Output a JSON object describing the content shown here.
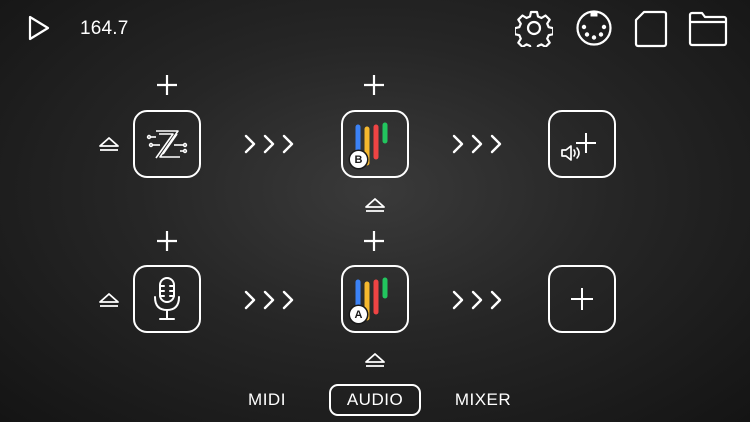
{
  "transport": {
    "tempo": "164.7",
    "play_icon": "play-icon"
  },
  "toolbar": {
    "icons": [
      "settings-gear-icon",
      "midi-connector-icon",
      "document-icon",
      "folder-icon"
    ]
  },
  "chains": [
    {
      "input": "zeeon-synth-icon",
      "effect_badge": "B",
      "output": "add-audio-output-icon"
    },
    {
      "input": "microphone-icon",
      "effect_badge": "A",
      "output": "add-slot-icon"
    }
  ],
  "meter_colors": [
    "#3b82f6",
    "#f5b82e",
    "#ef4444",
    "#22c55e"
  ],
  "tabs": [
    {
      "label": "MIDI",
      "active": false
    },
    {
      "label": "AUDIO",
      "active": true
    },
    {
      "label": "MIXER",
      "active": false
    }
  ]
}
